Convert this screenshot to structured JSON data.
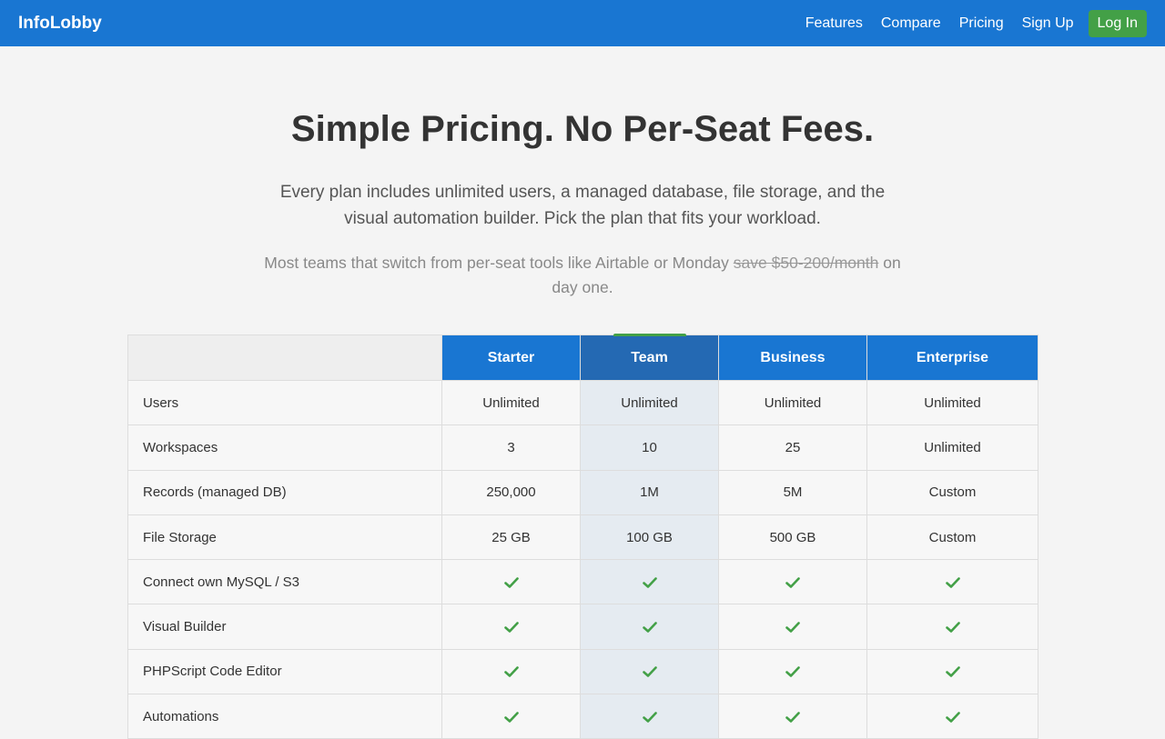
{
  "nav": {
    "brand": "InfoLobby",
    "links": [
      "Features",
      "Compare",
      "Pricing",
      "Sign Up"
    ],
    "login": "Log In"
  },
  "hero": {
    "title": "Simple Pricing. No Per-Seat Fees.",
    "subtitle": "Every plan includes unlimited users, a managed database, file storage, and the visual automation builder. Pick the plan that fits your workload.",
    "note_before": "Most teams that switch from per-seat tools like Airtable or Monday",
    "note_strike": "save $50-200/month",
    "note_after": "on day one."
  },
  "table": {
    "plans": [
      "Starter",
      "Team",
      "Business",
      "Enterprise"
    ],
    "highlight_plan": "Team",
    "rows": [
      {
        "feature": "Users",
        "values": [
          "Unlimited",
          "Unlimited",
          "Unlimited",
          "Unlimited"
        ]
      },
      {
        "feature": "Workspaces",
        "values": [
          "3",
          "10",
          "25",
          "Unlimited"
        ]
      },
      {
        "feature": "Records (managed DB)",
        "values": [
          "250,000",
          "1M",
          "5M",
          "Custom"
        ]
      },
      {
        "feature": "File Storage",
        "values": [
          "25 GB",
          "100 GB",
          "500 GB",
          "Custom"
        ]
      },
      {
        "feature": "Connect own MySQL / S3",
        "values": [
          "check",
          "check",
          "check",
          "check"
        ]
      },
      {
        "feature": "Visual Builder",
        "values": [
          "check",
          "check",
          "check",
          "check"
        ]
      },
      {
        "feature": "PHPScript Code Editor",
        "values": [
          "check",
          "check",
          "check",
          "check"
        ]
      },
      {
        "feature": "Automations",
        "values": [
          "check",
          "check",
          "check",
          "check"
        ]
      }
    ]
  },
  "colors": {
    "primary": "#1976d2",
    "accent": "#43a047",
    "check": "#43a047"
  }
}
